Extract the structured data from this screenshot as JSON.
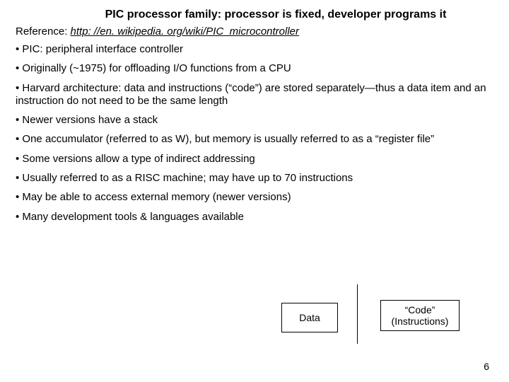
{
  "title": "PIC processor family: processor is fixed, developer programs it",
  "reference": {
    "label": "Reference:  ",
    "url_text": "http: //en. wikipedia. org/wiki/PIC_microcontroller"
  },
  "bullets": [
    "PIC:  peripheral interface controller",
    "Originally (~1975) for offloading I/O functions from a CPU",
    "Harvard architecture:  data and instructions (“code”) are stored separately—thus a data item and an instruction do not need to be the same length",
    "Newer versions have a stack",
    "One accumulator (referred to as W), but memory is usually referred to as a “register file”",
    "Some versions allow a type of indirect addressing",
    "Usually referred to as a RISC machine; may have up to 70 instructions",
    "May be able to access external memory (newer versions)",
    "Many development tools & languages available"
  ],
  "diagram": {
    "data_label": "Data",
    "code_label": "“Code” (Instructions)"
  },
  "page_number": "6"
}
